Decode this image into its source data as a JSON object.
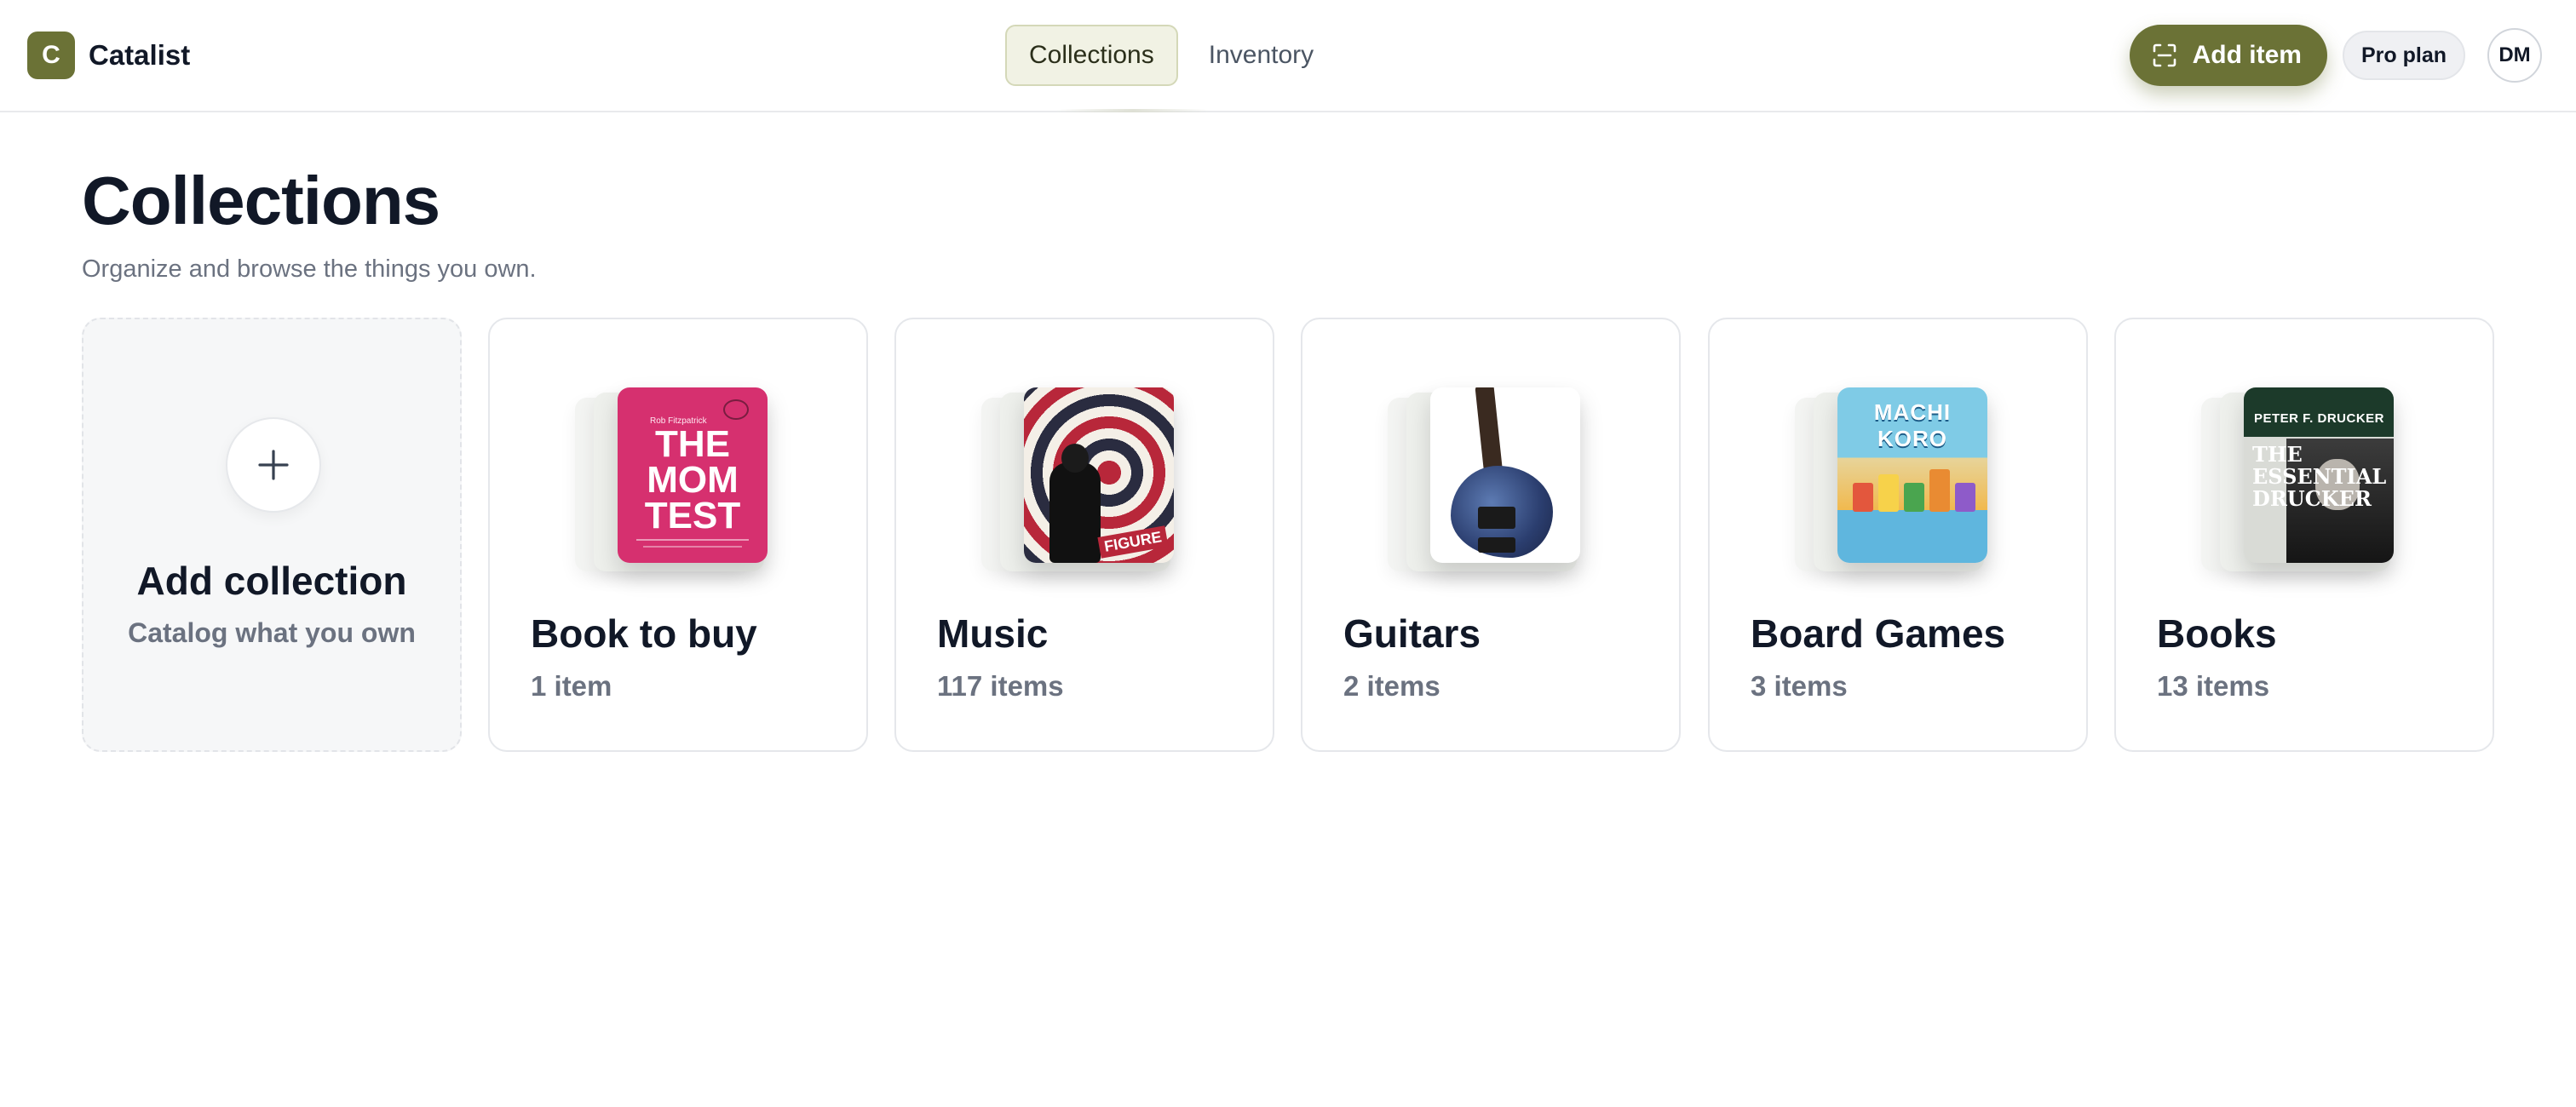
{
  "app": {
    "logo_letter": "C",
    "name": "Catalist",
    "brand_color": "#6b7236"
  },
  "nav": {
    "tabs": [
      {
        "label": "Collections",
        "active": true
      },
      {
        "label": "Inventory",
        "active": false
      }
    ]
  },
  "header_actions": {
    "add_item_label": "Add item",
    "add_item_icon": "scan-icon",
    "plan_badge": "Pro plan",
    "avatar_initials": "DM"
  },
  "page": {
    "title": "Collections",
    "subtitle": "Organize and browse the things you own."
  },
  "add_collection": {
    "icon": "plus-icon",
    "title": "Add collection",
    "subtitle": "Catalog what you own"
  },
  "collections": [
    {
      "name": "Book to buy",
      "count": "1 item",
      "cover": "the-mom-test-book-cover",
      "cover_text": "THE MOM TEST",
      "cover_author": "Rob Fitzpatrick"
    },
    {
      "name": "Music",
      "count": "117 items",
      "cover": "music-album-covers",
      "cover_text": "FIGURE"
    },
    {
      "name": "Guitars",
      "count": "2 items",
      "cover": "bass-guitar-photo"
    },
    {
      "name": "Board Games",
      "count": "3 items",
      "cover": "machi-koro-box-art",
      "cover_text": "MACHI KORO"
    },
    {
      "name": "Books",
      "count": "13 items",
      "cover": "essential-drucker-book-cover",
      "cover_author": "PETER F. DRUCKER",
      "cover_text": "THE ESSENTIAL DRUCKER"
    }
  ]
}
